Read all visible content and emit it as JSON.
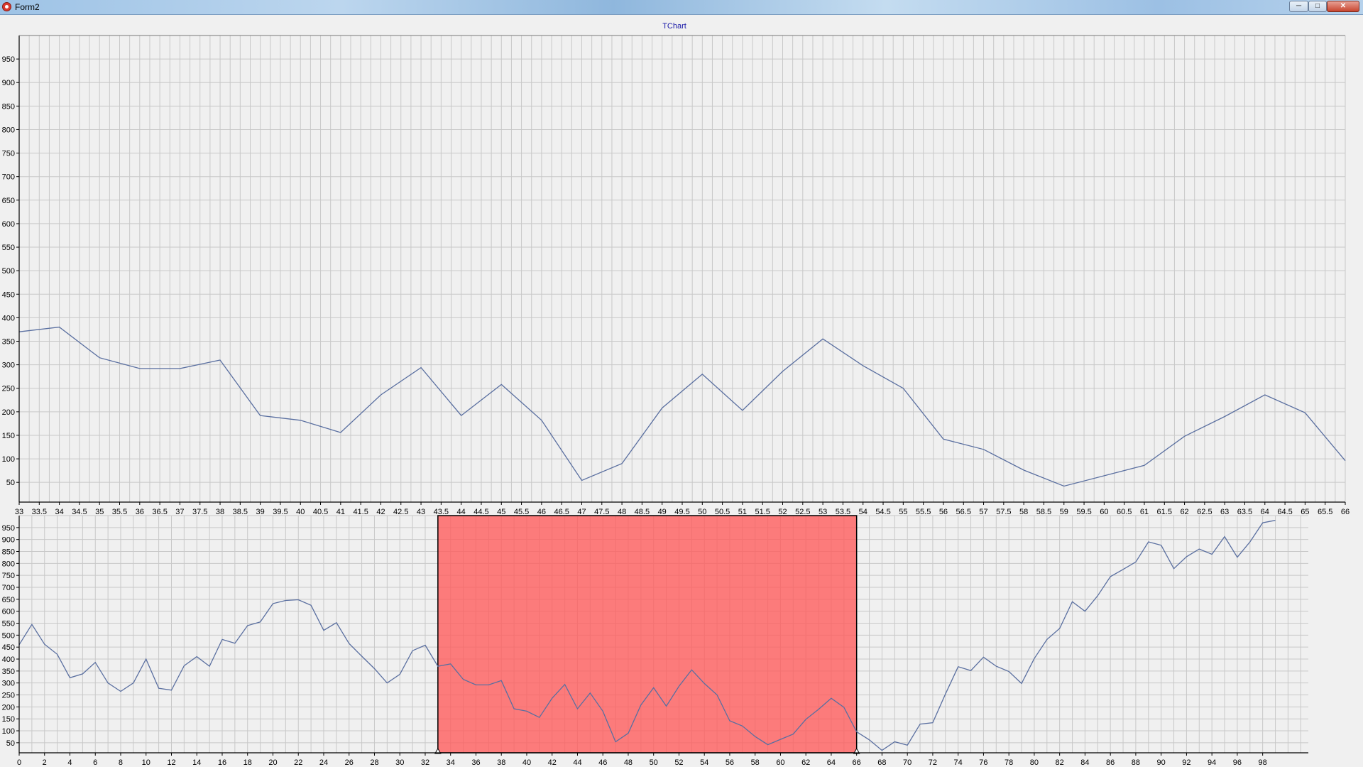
{
  "window": {
    "title": "Form2",
    "minimize_icon": "minimize-icon",
    "maximize_icon": "maximize-icon",
    "close_icon": "close-icon"
  },
  "chart_title": "TChart",
  "colors": {
    "series": "#5a6fa0",
    "highlight_fill": "#ff5a5a",
    "highlight_border": "#000000",
    "grid": "#c8c8c8",
    "panel": "#f0f0f0"
  },
  "chart_data": [
    {
      "type": "line",
      "role": "zoomed-detail",
      "x": [
        33,
        34,
        35,
        36,
        37,
        38,
        39,
        40,
        41,
        42,
        43,
        44,
        45,
        46,
        47,
        48,
        49,
        50,
        51,
        52,
        53,
        54,
        55,
        56,
        57,
        58,
        59,
        60,
        61,
        62,
        63,
        64,
        65,
        66
      ],
      "y": [
        370,
        380,
        315,
        292,
        292,
        310,
        192,
        182,
        156,
        236,
        294,
        192,
        258,
        182,
        54,
        90,
        208,
        280,
        203,
        286,
        355,
        298,
        250,
        142,
        120,
        76,
        42,
        64,
        86,
        148,
        190,
        236,
        198,
        96
      ],
      "xlim": [
        33,
        66
      ],
      "ylim": [
        8,
        1000
      ],
      "x_tick_labels": [
        "33",
        "33.5",
        "34",
        "34.5",
        "35",
        "35.5",
        "36",
        "36.5",
        "37",
        "37.5",
        "38",
        "38.5",
        "39",
        "39.5",
        "40",
        "40.5",
        "41",
        "41.5",
        "42",
        "42.5",
        "43",
        "43.5",
        "44",
        "44.5",
        "45",
        "45.5",
        "46",
        "46.5",
        "47",
        "47.5",
        "48",
        "48.5",
        "49",
        "49.5",
        "50",
        "50.5",
        "51",
        "51.5",
        "52",
        "52.5",
        "53",
        "53.5",
        "54",
        "54.5",
        "55",
        "55.5",
        "56",
        "56.5",
        "57",
        "57.5",
        "58",
        "58.5",
        "59",
        "59.5",
        "60",
        "60.5",
        "61",
        "61.5",
        "62",
        "62.5",
        "63",
        "63.5",
        "64",
        "64.5",
        "65",
        "65.5",
        "66"
      ],
      "y_tick_labels": [
        "50",
        "100",
        "150",
        "200",
        "250",
        "300",
        "350",
        "400",
        "450",
        "500",
        "550",
        "600",
        "650",
        "700",
        "750",
        "800",
        "850",
        "900",
        "950"
      ],
      "grid": true
    },
    {
      "type": "line",
      "role": "overview",
      "x": [
        0,
        1,
        2,
        3,
        4,
        5,
        6,
        7,
        8,
        9,
        10,
        11,
        12,
        13,
        14,
        15,
        16,
        17,
        18,
        19,
        20,
        21,
        22,
        23,
        24,
        25,
        26,
        27,
        28,
        29,
        30,
        31,
        32,
        33,
        34,
        35,
        36,
        37,
        38,
        39,
        40,
        41,
        42,
        43,
        44,
        45,
        46,
        47,
        48,
        49,
        50,
        51,
        52,
        53,
        54,
        55,
        56,
        57,
        58,
        59,
        60,
        61,
        62,
        63,
        64,
        65,
        66,
        67,
        68,
        69,
        70,
        71,
        72,
        73,
        74,
        75,
        76,
        77,
        78,
        79,
        80,
        81,
        82,
        83,
        84,
        85,
        86,
        87,
        88,
        89,
        90,
        91,
        92,
        93,
        94,
        95,
        96,
        97,
        98,
        99
      ],
      "y": [
        460,
        545,
        462,
        420,
        322,
        338,
        386,
        300,
        265,
        300,
        400,
        278,
        270,
        372,
        410,
        370,
        482,
        466,
        540,
        555,
        632,
        645,
        648,
        625,
        520,
        552,
        465,
        412,
        360,
        300,
        336,
        435,
        458,
        370,
        380,
        315,
        292,
        292,
        310,
        192,
        182,
        156,
        236,
        294,
        192,
        258,
        182,
        54,
        90,
        208,
        280,
        203,
        286,
        355,
        298,
        250,
        142,
        120,
        76,
        42,
        64,
        86,
        148,
        190,
        236,
        198,
        96,
        62,
        18,
        54,
        40,
        128,
        134,
        254,
        368,
        352,
        408,
        370,
        348,
        298,
        402,
        482,
        528,
        640,
        600,
        665,
        745,
        775,
        806,
        890,
        876,
        778,
        828,
        860,
        838,
        912,
        826,
        890,
        970,
        980
      ],
      "xlim": [
        0,
        101.6
      ],
      "ylim": [
        8,
        1000
      ],
      "x_tick_labels": [
        "0",
        "2",
        "4",
        "6",
        "8",
        "10",
        "12",
        "14",
        "16",
        "18",
        "20",
        "22",
        "24",
        "26",
        "28",
        "30",
        "32",
        "34",
        "36",
        "38",
        "40",
        "42",
        "44",
        "46",
        "48",
        "50",
        "52",
        "54",
        "56",
        "58",
        "60",
        "62",
        "64",
        "66",
        "68",
        "70",
        "72",
        "74",
        "76",
        "78",
        "80",
        "82",
        "84",
        "86",
        "88",
        "90",
        "92",
        "94",
        "96",
        "98"
      ],
      "y_tick_labels": [
        "50",
        "100",
        "150",
        "200",
        "250",
        "300",
        "350",
        "400",
        "450",
        "500",
        "550",
        "600",
        "650",
        "700",
        "750",
        "800",
        "850",
        "900",
        "950"
      ],
      "grid": true,
      "highlight": {
        "x_from": 33,
        "x_to": 66
      }
    }
  ]
}
